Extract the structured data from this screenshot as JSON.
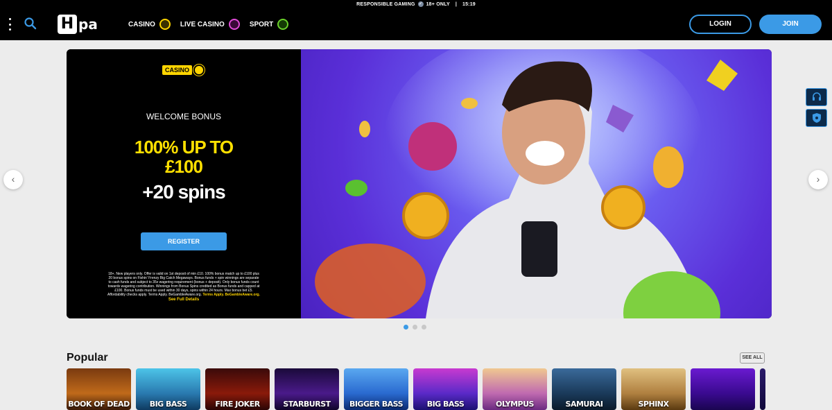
{
  "topbar": {
    "responsible_gaming": "RESPONSIBLE GAMING",
    "age": "18+ ONLY",
    "separator": "|",
    "time": "15:19"
  },
  "header": {
    "logo_h": "H",
    "logo_rest": "pa",
    "nav": [
      {
        "label": "CASINO",
        "color": "#ffd500"
      },
      {
        "label": "LIVE CASINO",
        "color": "#e04bd8"
      },
      {
        "label": "SPORT",
        "color": "#6ad12a"
      }
    ],
    "login": "LOGIN",
    "join": "JOIN"
  },
  "banner": {
    "category": "CASINO",
    "welcome": "WELCOME BONUS",
    "bonus_line1": "100% UP TO",
    "bonus_line2": "£100",
    "spins": "+20 spins",
    "register": "REGISTER",
    "terms": "18+. New players only. Offer is valid on 1st deposit of min £10. 100% bonus match up to £100 plus 20 bonus spins on Fishin' Frenzy Big Catch Megaways. Bonus funds + spin winnings are separate to cash funds and subject to 35x wagering requirement (bonus + deposit). Only bonus funds count towards wagering contribution. Winnings from Bonus Spins credited as Bonus funds and capped at £100. Bonus funds must be used within 30 days, spins within 24 hours. Max bonus bet £5. Affordability checks apply. Terms Apply. BeGambleAware.org.",
    "terms_link": "Terms Apply. BeGambleAware.org.",
    "see_full": "See Full Details",
    "prev": "‹",
    "next": "›",
    "slide_count": 3,
    "active_slide": 1
  },
  "popular": {
    "title": "Popular",
    "see_all": "SEE ALL",
    "games": [
      {
        "title": "BOOK OF DEAD",
        "bg": "linear-gradient(180deg,#7a3a10,#c06a1a 60%,#3a1a08)"
      },
      {
        "title": "BIG BASS",
        "bg": "linear-gradient(180deg,#4cc4e8,#2a7ab0 60%,#0e3a60)"
      },
      {
        "title": "FIRE JOKER",
        "bg": "linear-gradient(180deg,#3a0a0a,#8a1a0a 60%,#2a0505)"
      },
      {
        "title": "STARBURST",
        "bg": "linear-gradient(180deg,#1a0a3a,#4a1a8a 60%,#10052a)"
      },
      {
        "title": "BIGGER BASS",
        "bg": "linear-gradient(180deg,#5aa8f0,#2a6ad0 60%,#0a2a70)"
      },
      {
        "title": "BIG BASS",
        "bg": "linear-gradient(180deg,#c83ad0,#5a2ac8 60%,#1a1070)"
      },
      {
        "title": "OLYMPUS",
        "bg": "linear-gradient(180deg,#f0c890,#c06ab0 60%,#6a2a80)"
      },
      {
        "title": "SAMURAI",
        "bg": "linear-gradient(180deg,#3a6a9a,#1a3a5a 60%,#0a1a2a)"
      },
      {
        "title": "SPHINX",
        "bg": "linear-gradient(180deg,#e0c080,#b08040 60%,#5a3a10)"
      },
      {
        "title": "",
        "bg": "linear-gradient(180deg,#6a1ad0,#3a0a90 60%,#1a0550)"
      },
      {
        "title": "",
        "bg": "linear-gradient(180deg,#2a1a6a,#10083a)"
      }
    ]
  }
}
